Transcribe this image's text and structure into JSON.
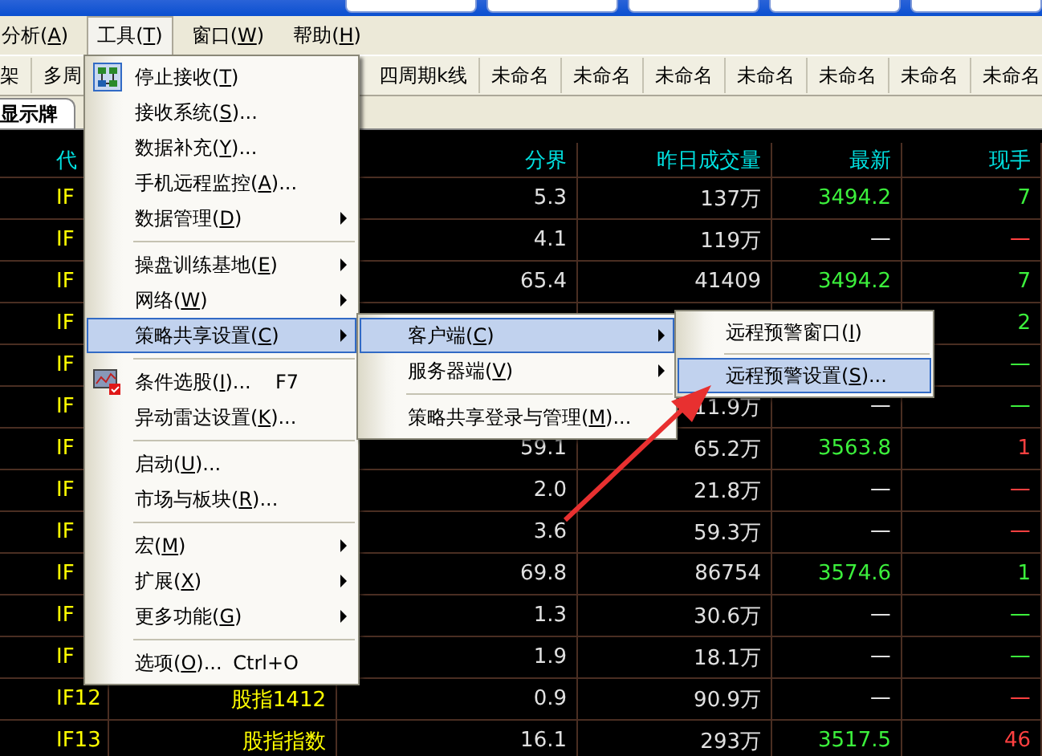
{
  "menu_bar": [
    {
      "label": "分析(A)",
      "selected": false
    },
    {
      "label": "工具(T)",
      "selected": true
    },
    {
      "label": "窗口(W)",
      "selected": false
    },
    {
      "label": "帮助(H)",
      "selected": false
    }
  ],
  "toolbar": [
    {
      "label": "架"
    },
    {
      "label": "多周"
    },
    {
      "label": "四周期k线"
    },
    {
      "label": "未命名"
    },
    {
      "label": "未命名"
    },
    {
      "label": "未命名"
    },
    {
      "label": "未命名"
    },
    {
      "label": "未命名"
    },
    {
      "label": "未命名"
    },
    {
      "label": "未命名"
    }
  ],
  "tab": {
    "label": "显示牌"
  },
  "table": {
    "columns": [
      "代",
      null,
      "分界",
      "昨日成交量",
      "最新",
      "现手"
    ],
    "rows": [
      {
        "code": "IF",
        "split": "5.3",
        "volume": "137万",
        "last": {
          "text": "3494.2",
          "color": "#3cf03c"
        },
        "hand": {
          "text": "7",
          "color": "#3cf03c"
        }
      },
      {
        "code": "IF",
        "split": "4.1",
        "volume": "119万",
        "last": {
          "text": "一",
          "color": "#e0e0e0"
        },
        "hand": {
          "text": "一",
          "color": "#ff4040"
        }
      },
      {
        "code": "IF",
        "split": "65.4",
        "volume": "41409",
        "last": {
          "text": "3494.2",
          "color": "#3cf03c"
        },
        "hand": {
          "text": "7",
          "color": "#3cf03c"
        }
      },
      {
        "code": "IF",
        "hand": {
          "text": "2",
          "color": "#3cf03c"
        }
      },
      {
        "code": "IF",
        "hand": {
          "text": "一",
          "color": "#3cf03c"
        }
      },
      {
        "code": "IF",
        "volume": "11.9万",
        "last": {
          "text": "一",
          "color": "#e0e0e0"
        },
        "hand": {
          "text": "一",
          "color": "#3cf03c"
        }
      },
      {
        "code": "IF",
        "split": "59.1",
        "volume": "65.2万",
        "last": {
          "text": "3563.8",
          "color": "#3cf03c"
        },
        "hand": {
          "text": "1",
          "color": "#ff4040"
        }
      },
      {
        "code": "IF",
        "split": "2.0",
        "volume": "21.8万",
        "last": {
          "text": "一",
          "color": "#e0e0e0"
        },
        "hand": {
          "text": "一",
          "color": "#ff4040"
        }
      },
      {
        "code": "IF",
        "split": "3.6",
        "volume": "59.3万",
        "last": {
          "text": "一",
          "color": "#e0e0e0"
        },
        "hand": {
          "text": "一",
          "color": "#ff4040"
        }
      },
      {
        "code": "IF",
        "split": "69.8",
        "volume": "86754",
        "last": {
          "text": "3574.6",
          "color": "#3cf03c"
        },
        "hand": {
          "text": "1",
          "color": "#3cf03c"
        }
      },
      {
        "code": "IF",
        "split": "1.3",
        "volume": "30.6万",
        "last": {
          "text": "一",
          "color": "#e0e0e0"
        },
        "hand": {
          "text": "一",
          "color": "#3cf03c"
        }
      },
      {
        "code": "IF",
        "split": "1.9",
        "volume": "18.1万",
        "last": {
          "text": "一",
          "color": "#e0e0e0"
        },
        "hand": {
          "text": "一",
          "color": "#3cf03c"
        }
      },
      {
        "code": "IF12",
        "name": "股指1412",
        "split": "0.9",
        "volume": "90.9万",
        "last": {
          "text": "一",
          "color": "#e0e0e0"
        },
        "hand": {
          "text": "一",
          "color": "#ff4040"
        }
      },
      {
        "code": "IF13",
        "name": "股指指数",
        "split": "16.1",
        "volume": "293万",
        "last": {
          "text": "3517.5",
          "color": "#3cf03c"
        },
        "hand": {
          "text": "46",
          "color": "#ff4040"
        }
      }
    ]
  },
  "tools_menu": [
    {
      "kind": "item",
      "label": "停止接收(T)",
      "selected": false
    },
    {
      "kind": "item",
      "label": "接收系统(S)...",
      "selected": false
    },
    {
      "kind": "item",
      "label": "数据补充(Y)...",
      "selected": false
    },
    {
      "kind": "item",
      "label": "手机远程监控(A)...",
      "selected": false
    },
    {
      "kind": "item",
      "label": "数据管理(D)",
      "submenu": true,
      "selected": false
    },
    {
      "kind": "separator"
    },
    {
      "kind": "item",
      "label": "操盘训练基地(E)",
      "submenu": true,
      "selected": false
    },
    {
      "kind": "item",
      "label": "网络(W)",
      "submenu": true,
      "selected": false
    },
    {
      "kind": "item",
      "label": "策略共享设置(C)",
      "submenu": true,
      "selected": true
    },
    {
      "kind": "separator"
    },
    {
      "kind": "item",
      "label": "条件选股(I)...",
      "shortcut": "F7",
      "selected": false
    },
    {
      "kind": "item",
      "label": "异动雷达设置(K)...",
      "selected": false
    },
    {
      "kind": "separator"
    },
    {
      "kind": "item",
      "label": "启动(U)...",
      "selected": false
    },
    {
      "kind": "item",
      "label": "市场与板块(R)...",
      "selected": false
    },
    {
      "kind": "separator"
    },
    {
      "kind": "item",
      "label": "宏(M)",
      "submenu": true,
      "selected": false
    },
    {
      "kind": "item",
      "label": "扩展(X)",
      "submenu": true,
      "selected": false
    },
    {
      "kind": "item",
      "label": "更多功能(G)",
      "submenu": true,
      "selected": false
    },
    {
      "kind": "separator"
    },
    {
      "kind": "item",
      "label": "选项(O)...",
      "shortcut": "Ctrl+O",
      "selected": false
    }
  ],
  "share_menu": [
    {
      "kind": "item",
      "label": "客户端(C)",
      "submenu": true,
      "selected": true
    },
    {
      "kind": "item",
      "label": "服务器端(V)",
      "submenu": true,
      "selected": false
    },
    {
      "kind": "separator"
    },
    {
      "kind": "item",
      "label": "策略共享登录与管理(M)...",
      "selected": false
    }
  ],
  "client_menu": [
    {
      "kind": "item",
      "label": "远程预警窗口(I)",
      "selected": false
    },
    {
      "kind": "separator"
    },
    {
      "kind": "item",
      "label": "远程预警设置(S)...",
      "selected": true
    }
  ]
}
